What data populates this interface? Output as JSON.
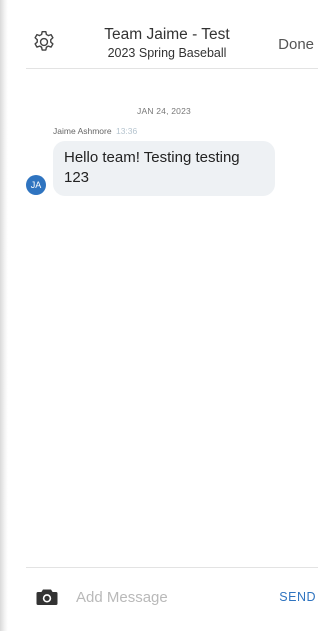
{
  "header": {
    "title": "Team Jaime - Test",
    "subtitle": "2023 Spring Baseball",
    "done_label": "Done",
    "settings_icon": "gear-icon"
  },
  "conversation": {
    "date_divider": "JAN 24, 2023",
    "messages": [
      {
        "author": "Jaime Ashmore",
        "time": "13:36",
        "avatar_initials": "JA",
        "avatar_color": "#2f74c0",
        "text": "Hello team!  Testing testing 123"
      }
    ]
  },
  "composer": {
    "camera_icon": "camera-icon",
    "placeholder": "Add Message",
    "value": "",
    "send_label": "SEND"
  },
  "colors": {
    "accent": "#2f74c0",
    "bubble": "#eef1f4"
  }
}
